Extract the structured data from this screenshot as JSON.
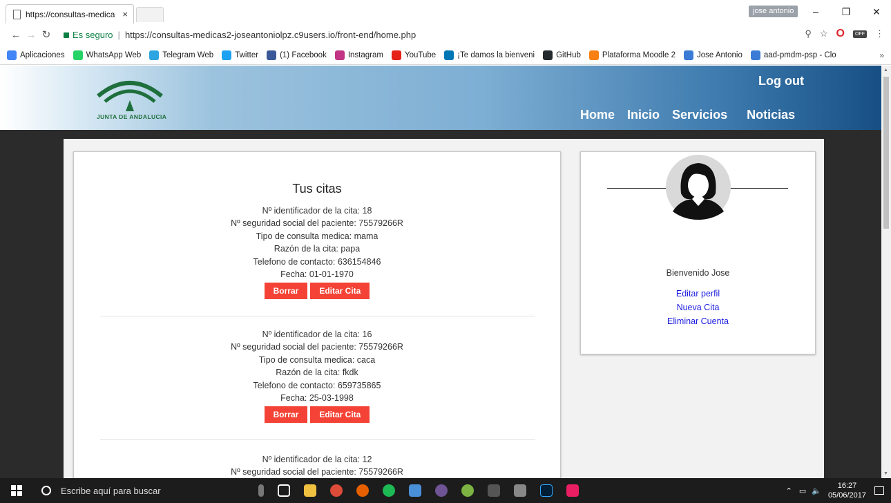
{
  "browser": {
    "tab_title": "https://consultas-medica",
    "tab_close": "×",
    "user_badge": "jose antonio",
    "secure_label": "Es seguro",
    "url": "https://consultas-medicas2-joseantoniolpz.c9users.io/front-end/home.php",
    "off_badge": "OFF",
    "bookmarks": [
      {
        "label": "Aplicaciones",
        "color": "#4285f4"
      },
      {
        "label": "WhatsApp Web",
        "color": "#25d366"
      },
      {
        "label": "Telegram Web",
        "color": "#2ca5e0"
      },
      {
        "label": "Twitter",
        "color": "#1da1f2"
      },
      {
        "label": "(1) Facebook",
        "color": "#3b5998"
      },
      {
        "label": "Instagram",
        "color": "#c13584"
      },
      {
        "label": "YouTube",
        "color": "#e62117"
      },
      {
        "label": "¡Te damos la bienveni",
        "color": "#0077b5"
      },
      {
        "label": "GitHub",
        "color": "#24292e"
      },
      {
        "label": "Plataforma Moodle 2",
        "color": "#f98012"
      },
      {
        "label": "Jose Antonio",
        "color": "#3a7bd5"
      },
      {
        "label": "aad-pmdm-psp - Clo",
        "color": "#3a7bd5"
      }
    ]
  },
  "site": {
    "logo_text": "JUNTA DE ANDALUCIA",
    "logout": "Log out",
    "nav": [
      "Home",
      "Inicio",
      "Servicios",
      "Noticias"
    ],
    "card_title": "Tus citas",
    "appointments": [
      {
        "id": "Nº identificador de la cita: 18",
        "ssn": "Nº seguridad social del paciente: 75579266R",
        "type": "Tipo de consulta medica: mama",
        "reason": "Razón de la cita: papa",
        "phone": "Telefono de contacto: 636154846",
        "date": "Fecha: 01-01-1970"
      },
      {
        "id": "Nº identificador de la cita: 16",
        "ssn": "Nº seguridad social del paciente: 75579266R",
        "type": "Tipo de consulta medica: caca",
        "reason": "Razón de la cita: fkdk",
        "phone": "Telefono de contacto: 659735865",
        "date": "Fecha: 25-03-1998"
      },
      {
        "id": "Nº identificador de la cita: 12",
        "ssn": "Nº seguridad social del paciente: 75579266R"
      }
    ],
    "delete_label": "Borrar",
    "edit_label": "Editar Cita",
    "welcome": "Bienvenido Jose",
    "profile_links": [
      "Editar perfil",
      "Nueva Cita",
      "Eliminar Cuenta"
    ]
  },
  "taskbar": {
    "search_placeholder": "Escribe aquí para buscar",
    "time": "16:27",
    "date": "05/06/2017"
  },
  "colors": {
    "button_red": "#f44336",
    "link_blue": "#1a1ae0",
    "andalucia_green": "#1f6f3c",
    "secure_green": "#0b8043"
  }
}
